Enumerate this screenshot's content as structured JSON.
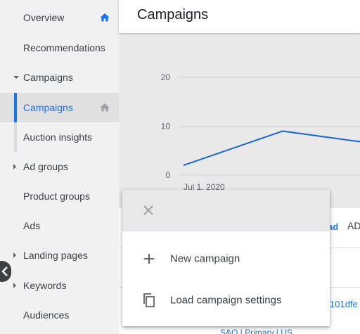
{
  "sidebar": {
    "items": [
      {
        "label": "Overview"
      },
      {
        "label": "Recommendations"
      },
      {
        "label": "Campaigns"
      },
      {
        "label": "Campaigns"
      },
      {
        "label": "Auction insights"
      },
      {
        "label": "Ad groups"
      },
      {
        "label": "Product groups"
      },
      {
        "label": "Ads"
      },
      {
        "label": "Landing pages"
      },
      {
        "label": "Keywords"
      },
      {
        "label": "Audiences"
      }
    ]
  },
  "header": {
    "title": "Campaigns"
  },
  "chart_data": {
    "type": "line",
    "x": [
      "Jul 1, 2020",
      "",
      ""
    ],
    "x_tick_label": "Jul 1, 2020",
    "y_ticks": [
      "20",
      "10",
      "0"
    ],
    "ylim": [
      0,
      20
    ],
    "series": [
      {
        "values": [
          2,
          9,
          6.5
        ]
      }
    ],
    "grid": true
  },
  "content": {
    "peek_link": "ad",
    "peek_tab": "AD",
    "peek_id": "101dfe",
    "peek_row": "S&O | Primary | US"
  },
  "menu": {
    "items": [
      {
        "label": "New campaign",
        "icon": "plus-icon"
      },
      {
        "label": "Load campaign settings",
        "icon": "copy-icon"
      }
    ]
  },
  "colors": {
    "accent": "#1a73e8",
    "line": "#1967d2"
  }
}
